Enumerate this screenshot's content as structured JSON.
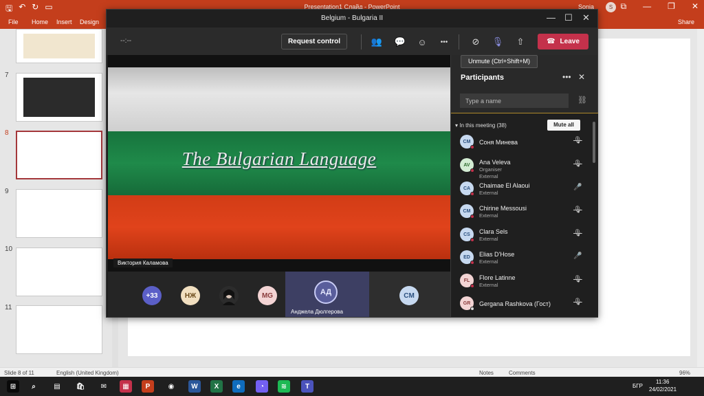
{
  "ppt": {
    "window_title": "Presentation1 Слайд - PowerPoint",
    "user": "Sonia",
    "user_initial": "S",
    "qat": {
      "save": "🖫",
      "undo": "↶",
      "redo": "↻",
      "present": "▭"
    },
    "win": {
      "min": "—",
      "restore": "❐",
      "close": "✕",
      "ribbon_opts": "⧉"
    },
    "tabs": [
      "File",
      "Home",
      "Insert",
      "Design"
    ],
    "share": "Share",
    "slides": [
      {
        "num": "7"
      },
      {
        "num": "8"
      },
      {
        "num": "9"
      },
      {
        "num": "10"
      },
      {
        "num": "11"
      }
    ],
    "status": {
      "slide_info": "Slide 8 of 11",
      "language": "English (United Kingdom)",
      "notes": "Notes",
      "comments": "Comments",
      "zoom": "96%"
    }
  },
  "taskbar": {
    "time": "11:36",
    "date": "24/02/2021",
    "lang": "БГР",
    "apps": [
      {
        "label": "⊞",
        "color": "#0a0a0a"
      },
      {
        "label": "⌕",
        "color": "#1f1f1f"
      },
      {
        "label": "▤",
        "color": "#1f1f1f"
      },
      {
        "label": "🛍",
        "color": "#1f1f1f"
      },
      {
        "label": "✉",
        "color": "#1f1f1f"
      },
      {
        "label": "▦",
        "color": "#c4314b"
      },
      {
        "label": "P",
        "color": "#c43e1c"
      },
      {
        "label": "◉",
        "color": "#1f1f1f"
      },
      {
        "label": "W",
        "color": "#2b579a"
      },
      {
        "label": "X",
        "color": "#217346"
      },
      {
        "label": "e",
        "color": "#0f6cbd"
      },
      {
        "label": "◔",
        "color": "#7360f2"
      },
      {
        "label": "≋",
        "color": "#1db954"
      },
      {
        "label": "T",
        "color": "#4b53bc"
      }
    ]
  },
  "teams": {
    "window_title": "Belgium - Bulgaria II",
    "timer": "--:--",
    "request_control": "Request control",
    "leave": "Leave",
    "tooltip": "Unmute (Ctrl+Shift+M)",
    "icons": {
      "people": "👥",
      "chat": "💬",
      "react": "☺",
      "more": "•••",
      "camera_off": "⊘",
      "mic_off": "🎙",
      "share": "⇧",
      "phone": "☎",
      "minimize": "—",
      "maximize": "☐",
      "close": "✕"
    },
    "stage": {
      "slide_title": "The Bulgarian Language",
      "presenter": "Виктория Каламова",
      "flag_colors": [
        "#e6e6e6",
        "#1f8a4a",
        "#e0431b"
      ]
    },
    "gallery": {
      "overflow": "+33",
      "tiles": [
        {
          "initials": "НЖ",
          "bg": "#f1dfc0",
          "fg": "#6b4a1a"
        },
        {
          "initials": "",
          "bg": "#2c2c2c",
          "fg": "#fff"
        },
        {
          "initials": "MG",
          "bg": "#f3d4d4",
          "fg": "#8a3b3b"
        }
      ],
      "active_speaker": {
        "initials": "АД",
        "name": "Анджела Дюлгерова"
      },
      "cm_tile": {
        "initials": "CM"
      }
    },
    "participants": {
      "title": "Participants",
      "search_placeholder": "Type a name",
      "section": "In this meeting (38)",
      "mute_all": "Mute all",
      "list": [
        {
          "initials": "CM",
          "name": "Соня Минева",
          "sub1": "",
          "sub2": "",
          "mic": "🎙",
          "muted": true,
          "bg": "#c7d9f0",
          "fg": "#2a4f7e",
          "dot": "red"
        },
        {
          "initials": "AV",
          "name": "Ana Veleva",
          "sub1": "Organiser",
          "sub2": "External",
          "mic": "🎙",
          "muted": true,
          "bg": "#d3ecd3",
          "fg": "#2e6b2e",
          "dot": "red"
        },
        {
          "initials": "CA",
          "name": "Chaimae El Alaoui",
          "sub1": "External",
          "sub2": "",
          "mic": "🎤",
          "muted": false,
          "bg": "#c7d9f0",
          "fg": "#2a4f7e",
          "dot": "red"
        },
        {
          "initials": "CM",
          "name": "Chirine Messousi",
          "sub1": "External",
          "sub2": "",
          "mic": "🎙",
          "muted": true,
          "bg": "#c7d9f0",
          "fg": "#2a4f7e",
          "dot": "red"
        },
        {
          "initials": "CS",
          "name": "Clara Sels",
          "sub1": "External",
          "sub2": "",
          "mic": "🎙",
          "muted": true,
          "bg": "#c7d9f0",
          "fg": "#2a4f7e",
          "dot": "red"
        },
        {
          "initials": "ED",
          "name": "Elias D'Hose",
          "sub1": "External",
          "sub2": "",
          "mic": "🎤",
          "muted": false,
          "bg": "#c7d9f0",
          "fg": "#2a4f7e",
          "dot": "red"
        },
        {
          "initials": "FL",
          "name": "Flore Latinne",
          "sub1": "External",
          "sub2": "",
          "mic": "🎙",
          "muted": true,
          "bg": "#f3d4d4",
          "fg": "#8a3b3b",
          "dot": "red"
        },
        {
          "initials": "GR",
          "name": "Gergana Rashkova (Гост)",
          "sub1": "",
          "sub2": "",
          "mic": "🎙",
          "muted": true,
          "bg": "#f3d4d4",
          "fg": "#8a3b3b",
          "dot": "white"
        }
      ]
    }
  }
}
